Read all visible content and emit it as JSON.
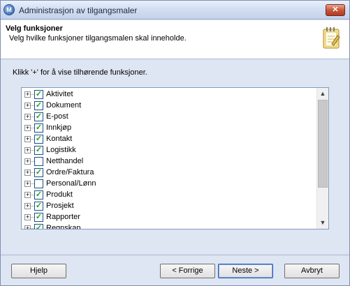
{
  "window": {
    "title": "Administrasjon av tilgangsmaler",
    "close_label": "✕"
  },
  "header": {
    "title": "Velg funksjoner",
    "subtitle": "Velg hvilke funksjoner tilgangsmalen skal inneholde."
  },
  "instruction": "Klikk '+' for å vise tilhørende funksjoner.",
  "list": {
    "items": [
      {
        "label": "Aktivitet",
        "checked": true
      },
      {
        "label": "Dokument",
        "checked": true
      },
      {
        "label": "E-post",
        "checked": true
      },
      {
        "label": "Innkjøp",
        "checked": true
      },
      {
        "label": "Kontakt",
        "checked": true
      },
      {
        "label": "Logistikk",
        "checked": true
      },
      {
        "label": "Netthandel",
        "checked": false
      },
      {
        "label": "Ordre/Faktura",
        "checked": true
      },
      {
        "label": "Personal/Lønn",
        "checked": false
      },
      {
        "label": "Produkt",
        "checked": true
      },
      {
        "label": "Prosjekt",
        "checked": true
      },
      {
        "label": "Rapporter",
        "checked": true
      },
      {
        "label": "Regnskap",
        "checked": true
      }
    ]
  },
  "buttons": {
    "help": "Hjelp",
    "back": "< Forrige",
    "next": "Neste >",
    "cancel": "Avbryt"
  },
  "icons": {
    "app": "app-logo-icon",
    "header": "wizard-notepad-icon",
    "expander": "expand-plus-icon",
    "check": "checkmark-icon"
  }
}
